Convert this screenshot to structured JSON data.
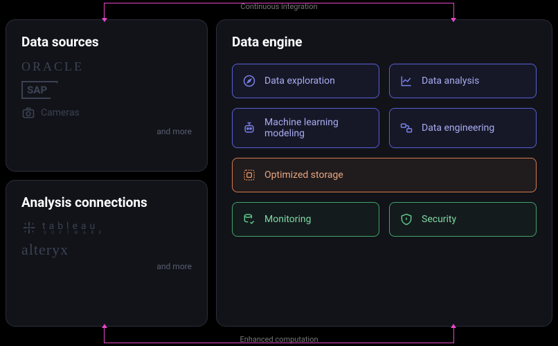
{
  "connectors": {
    "top": "Continuous integration",
    "bottom": "Enhanced computation"
  },
  "data_sources": {
    "title": "Data sources",
    "items": {
      "oracle": "ORACLE",
      "sap": "SAP",
      "cameras": "Cameras"
    },
    "more": "and more"
  },
  "analysis_connections": {
    "title": "Analysis connections",
    "tableau": {
      "text": "tableau",
      "sub": "S O F T W A R E"
    },
    "alteryx": "alteryx",
    "more": "and more"
  },
  "data_engine": {
    "title": "Data engine",
    "tiles": {
      "exploration": "Data exploration",
      "analysis": "Data analysis",
      "ml": "Machine learning modeling",
      "engineering": "Data engineering",
      "storage": "Optimized storage",
      "monitoring": "Monitoring",
      "security": "Security"
    }
  }
}
